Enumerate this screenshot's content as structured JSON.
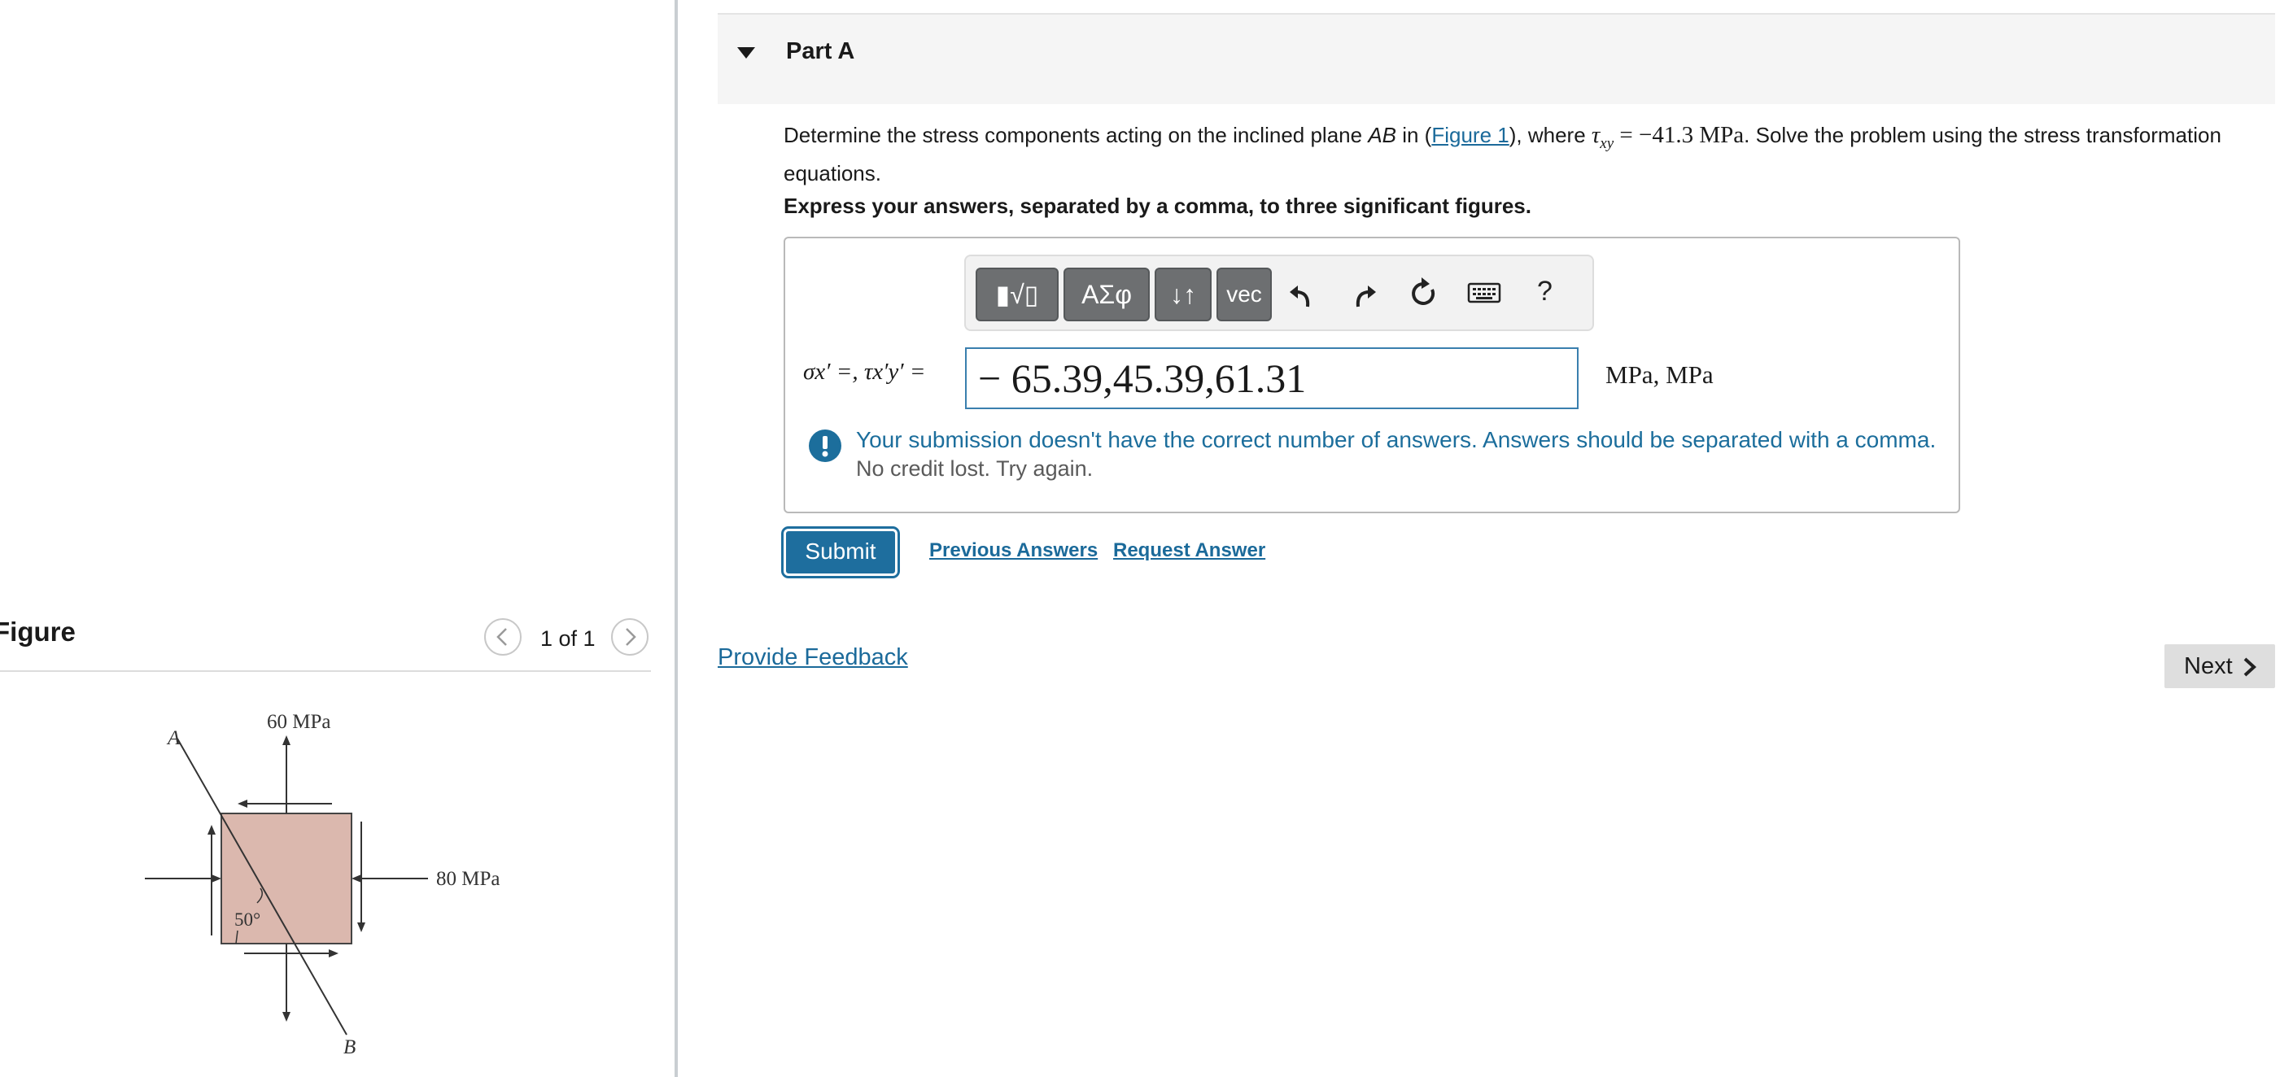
{
  "figure_panel": {
    "title": "Figure",
    "counter": "1 of 1",
    "diagram": {
      "label_a": "A",
      "label_b": "B",
      "top_stress": "60 MPa",
      "right_stress": "80 MPa",
      "angle": "50°"
    }
  },
  "part": {
    "title": "Part A",
    "question_pre": "Determine the stress components acting on the inclined plane ",
    "question_plane": "AB",
    "question_in": " in (",
    "figure_link": "Figure 1",
    "question_where": "), where ",
    "tau_symbol": "τ",
    "tau_sub": "xy",
    "tau_value": " = −41.3 ",
    "tau_unit": "MPa",
    "question_post": ". Solve the problem using the stress transformation equations.",
    "instruction": "Express your answers, separated by a comma, to three significant figures."
  },
  "toolbar": {
    "templates_label": "▮√▯",
    "greek_label": "ΑΣφ",
    "arrows_label": "↓↑",
    "vec_label": "vec",
    "help_label": "?"
  },
  "answer": {
    "label": "σx′ =, τx′y′ =",
    "value": "− 65.39,45.39,61.31",
    "units": "MPa, MPa"
  },
  "feedback": {
    "message": "Your submission doesn't have the correct number of answers. Answers should be separated with a comma.",
    "sub": "No credit lost. Try again."
  },
  "actions": {
    "submit": "Submit",
    "previous_answers": "Previous Answers",
    "request_answer": "Request Answer",
    "provide_feedback": "Provide Feedback",
    "next": "Next"
  },
  "colors": {
    "link": "#1b6a9a",
    "submit": "#1e6e9e",
    "toolbar_button": "#6d6f71",
    "element_fill": "#dbb8ae"
  }
}
